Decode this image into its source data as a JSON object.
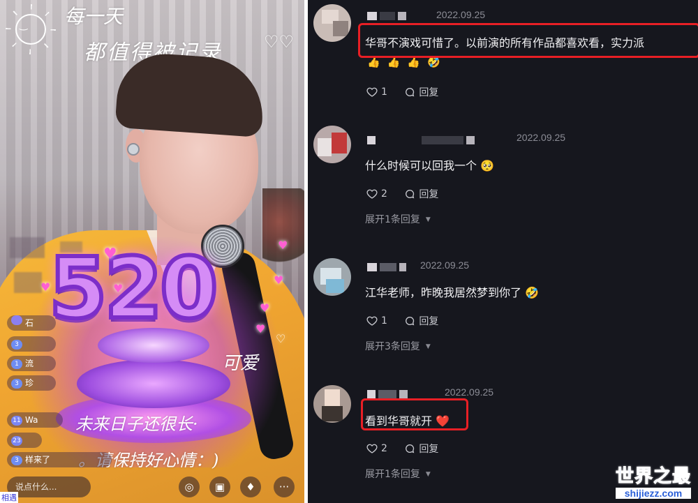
{
  "live": {
    "overlay_line1": "每一天",
    "overlay_line2": "都值得被记录",
    "gift_number": "520",
    "caption_cute": "可爱",
    "caption_future": "未来日子还很长·",
    "caption_mood": "。请保持好心情：)",
    "chat_rows": [
      {
        "level": "",
        "text": "石"
      },
      {
        "level": "3",
        "text": ""
      },
      {
        "level": "1",
        "text": "流"
      },
      {
        "level": "3",
        "text": "珍"
      },
      {
        "level": "11",
        "text": "Wa"
      },
      {
        "level": "23",
        "text": ""
      },
      {
        "level": "3",
        "text": "样来了"
      }
    ],
    "say_placeholder": "说点什么...",
    "corner_text": "相遇",
    "more_label": "···"
  },
  "comments": [
    {
      "date": "2022.09.25",
      "text": "华哥不演戏可惜了。以前演的所有作品都喜欢看，实力派",
      "emojis": [
        "👍",
        "👍",
        "👍",
        "🤣"
      ],
      "likes": "1",
      "reply_label": "回复",
      "expand_label": "",
      "highlighted": true
    },
    {
      "date": "2022.09.25",
      "text": "什么时候可以回我一个 🥺",
      "emojis": [],
      "likes": "2",
      "reply_label": "回复",
      "expand_label": "展开1条回复",
      "highlighted": false
    },
    {
      "date": "2022.09.25",
      "text": "江华老师，昨晚我居然梦到你了 🤣",
      "emojis": [],
      "likes": "1",
      "reply_label": "回复",
      "expand_label": "展开3条回复",
      "highlighted": false
    },
    {
      "date": "2022.09.25",
      "text": "看到华哥就开 ❤️",
      "emojis": [],
      "likes": "2",
      "reply_label": "回复",
      "expand_label": "展开1条回复",
      "highlighted": true
    }
  ],
  "watermark": {
    "title": "世界之最",
    "site": "shijiezz.com"
  },
  "colors": {
    "panel_bg": "#16171e",
    "highlight": "#e81f25",
    "gift_purple": "#d58cf6",
    "jacket": "#f0a531"
  }
}
